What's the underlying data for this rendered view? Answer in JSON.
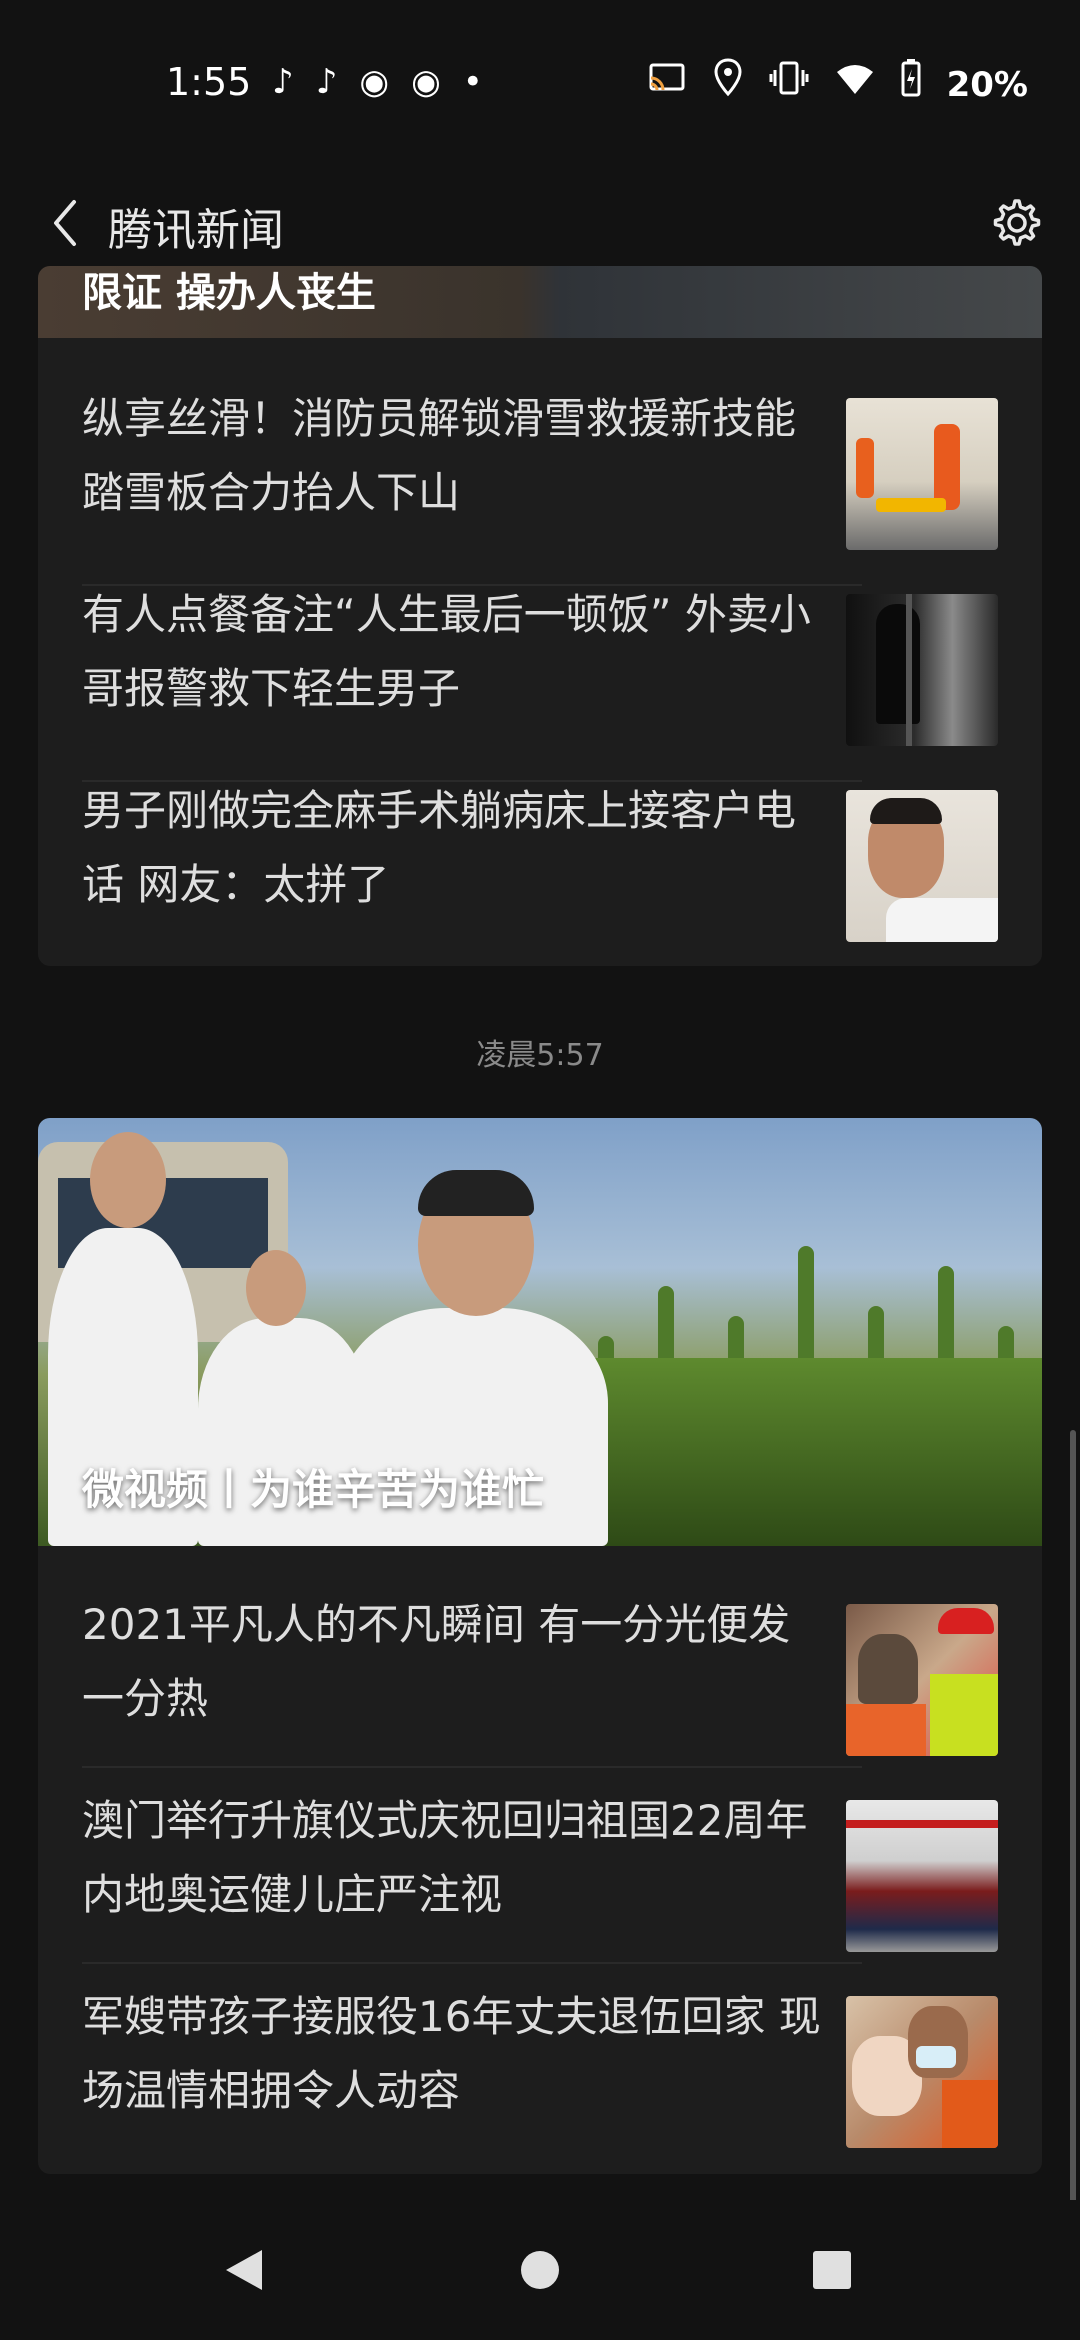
{
  "status_bar": {
    "time": "1:55",
    "icons_left": [
      "tiktok-icon",
      "tiktok-icon",
      "weibo-icon",
      "weibo-icon",
      "dot-icon"
    ],
    "icons_right": [
      "cast-icon",
      "location-icon",
      "vibrate-icon",
      "wifi-icon",
      "battery-icon"
    ],
    "battery": "20%"
  },
  "app_bar": {
    "title": "腾讯新闻"
  },
  "card_top": {
    "hero_title_partial": "限证 操办人丧生",
    "items": [
      {
        "title": "纵享丝滑！消防员解锁滑雪救援新技能 踏雪板合力抬人下山"
      },
      {
        "title": "有人点餐备注“人生最后一顿饭” 外卖小哥报警救下轻生男子"
      },
      {
        "title": "男子刚做完全麻手术躺病床上接客户电话 网友：太拼了"
      }
    ]
  },
  "timestamp": "凌晨5:57",
  "card_bottom": {
    "hero_title": "微视频丨为谁辛苦为谁忙",
    "items": [
      {
        "title": "2021平凡人的不凡瞬间 有一分光便发一分热"
      },
      {
        "title": "澳门举行升旗仪式庆祝回归祖国22周年 内地奥运健儿庄严注视"
      },
      {
        "title": "军嫂带孩子接服役16年丈夫退伍回家 现场温情相拥令人动容"
      }
    ]
  },
  "colors": {
    "background": "#121212",
    "card": "#1d1d1d",
    "text": "#dedede",
    "muted": "#8a8a8a"
  }
}
